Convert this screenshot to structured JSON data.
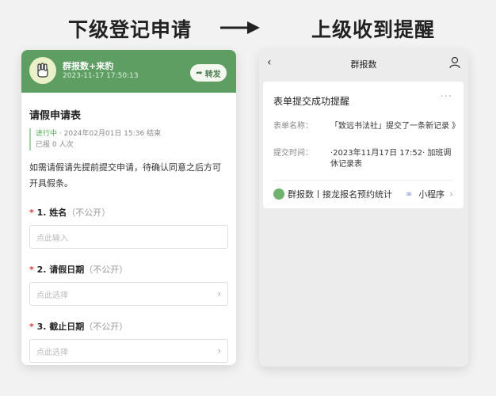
{
  "headings": {
    "left": "下级登记申请",
    "right": "上级收到提醒"
  },
  "left_phone": {
    "header": {
      "title": "群报数+来豹",
      "time": "2023-11-17 17:50:13",
      "share_label": "转发",
      "bg_color": "#5e9e63"
    },
    "form": {
      "title": "请假申请表",
      "status": "进行中",
      "date_range": "· 2024年02月01日 15:36 结束",
      "reported": "已报 0 人次",
      "description": "如需请假请先提前提交申请，待确认同意之后方可开具假条。",
      "fields": [
        {
          "num": "1. 姓名",
          "privacy": "（不公开）",
          "placeholder": "点此输入",
          "type": "input"
        },
        {
          "num": "2. 请假日期",
          "privacy": "（不公开）",
          "placeholder": "点此选择",
          "type": "select"
        },
        {
          "num": "3. 截止日期",
          "privacy": "（不公开）",
          "placeholder": "点此选择",
          "type": "select"
        }
      ],
      "required_mark": "*"
    }
  },
  "right_phone": {
    "nav_title": "群报数",
    "card": {
      "title": "表单提交成功提醒",
      "more": "···",
      "form_name_key": "表单名称：",
      "form_name_value": "「致远书法社」提交了一条新记录 》",
      "submit_time_key": "提交时间：",
      "submit_time_value": "·2023年11月17日 17:52· 加班调休记录表",
      "footer_left": "群报数丨接龙报名预约统计",
      "footer_right": "小程序"
    }
  }
}
